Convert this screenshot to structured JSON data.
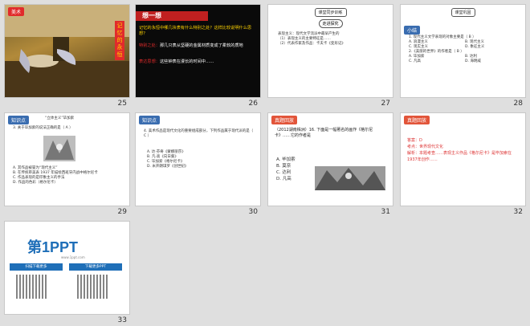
{
  "slides": [
    {
      "num": "25",
      "tag": "美术",
      "side_title": "记忆的永恒"
    },
    {
      "num": "26",
      "title": "想一想",
      "q1": "记忆的永恒中哪几块表有什么特别之处？这样比较说明什么思想？",
      "a1_label": "特别之处：",
      "a1": "那几只表从坚硬的金属材质变成了柔软的质地",
      "a2_label": "表达思想：",
      "a2": "这些钟表在漫长的时间中……"
    },
    {
      "num": "27",
      "header": "课堂同步训练",
      "title": "走进探究",
      "line1": "表现主义：现代文学流派中最早产生的",
      "line2": "（1）表现主义的主要特征是……",
      "line3": "（2）代表作家及作品：卡夫卡《变形记》"
    },
    {
      "num": "28",
      "header": "课堂巩固",
      "tag": "小结",
      "q": "1. 现代主义文学表现的对象主要是（ B ）",
      "opts": [
        "A. 浪漫主义",
        "B. 现代主义",
        "C. 现实主义",
        "D. 象征主义"
      ],
      "q2": "2.《美丽的世界》的作者是（ B ）",
      "opts2": [
        "A. 毕加索",
        "B. 达利",
        "C. 凡高",
        "D. 海明威"
      ]
    },
    {
      "num": "29",
      "tag": "知识点",
      "sub": "“立体主义”毕加索",
      "q": "3. 关于毕加索的说法正确的是（ A ）",
      "opts": [
        "A. 其作品被誉为“现代主义”",
        "B. 在传统审美表 1937 年描绘西班牙内战中格尔尼卡",
        "C. 作品表现的是印象主义的手法",
        "D. 作品的色彩（格尔尼卡）"
      ]
    },
    {
      "num": "30",
      "tag": "知识点",
      "q": "4. 美术作品是现代文化的重要组成部分，下列作品属于现代派的是（ C ）",
      "opts": [
        "A. 达·芬奇《蒙娜丽莎》",
        "B. 凡·高《向日葵》",
        "C. 毕加索《格尔尼卡》",
        "D. 米开朗琪罗《创世纪》"
      ]
    },
    {
      "num": "31",
      "tag": "真题回放",
      "q": "（2012湖南株洲）16. 下面是一幅著名的画作《格尔尼卡》……它的作者是",
      "opts": [
        "A. 毕加索",
        "B. 莫奈",
        "C. 达利",
        "D. 凡高"
      ]
    },
    {
      "num": "32",
      "tag": "真题回放",
      "ans_label": "答案：",
      "ans": "D",
      "kd_label": "考点：",
      "kd": "世界现代文化",
      "an_label": "解析：",
      "an": "本题考查……表现主义作品《格尔尼卡》是毕加索在1937年创作……"
    },
    {
      "num": "33",
      "brand": "第1PPT",
      "brand_sub": "www.1ppt.com",
      "btn1": "扫描下载更多",
      "btn2": "下载更多PPT"
    }
  ]
}
